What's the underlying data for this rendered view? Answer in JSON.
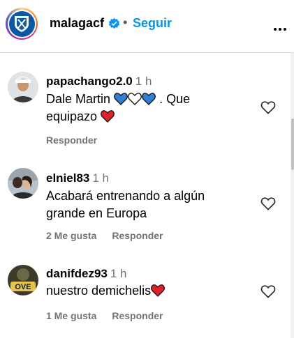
{
  "header": {
    "username": "malagacf",
    "separator": "•",
    "follow_label": "Seguir",
    "icons": {
      "verified": "verified-badge-icon",
      "more": "more-options-icon"
    }
  },
  "comments": [
    {
      "username": "papachango2.0",
      "time": "1 h",
      "text_part1": "Dale Martin",
      "text_part2": ". Que",
      "text_part3": "equipazo",
      "emojis": [
        "blue-heart",
        "white-heart",
        "blue-heart",
        "red-heart"
      ],
      "reply_label": "Responder"
    },
    {
      "username": "elniel83",
      "time": "1 h",
      "text": "Acabará entrenando a algún grande en Europa",
      "likes_label": "2 Me gusta",
      "reply_label": "Responder"
    },
    {
      "username": "danifdez93",
      "time": "1 h",
      "text": "nuestro demichelis",
      "emojis": [
        "red-heart"
      ],
      "likes_label": "1 Me gusta",
      "reply_label": "Responder"
    }
  ],
  "colors": {
    "accent": "#0095f6",
    "muted": "#737373",
    "blue_heart": "#2f7fd8",
    "red_heart": "#e0202a"
  }
}
